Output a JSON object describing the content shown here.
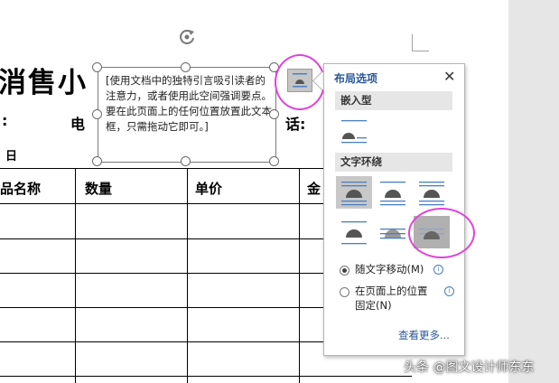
{
  "document": {
    "title_fragment": "消售小",
    "line1_left": ":",
    "line1_mid": "电",
    "line1_right": "话:",
    "line2_left": "日",
    "table_headers": [
      "品名称",
      "数量",
      "单价",
      "金"
    ]
  },
  "text_box": {
    "content": "[使用文档中的独特引言吸引读者的注意力，或者使用此空间强调要点。要在此页面上的任何位置放置此文本框，只需拖动它即可。]"
  },
  "layout_pane": {
    "title": "布局选项",
    "close": "✕",
    "inline_section": "嵌入型",
    "wrap_section": "文字环绕",
    "radio_move": "随文字移动(M)",
    "radio_fixed_line1": "在页面上的位置",
    "radio_fixed_line2": "固定(N)",
    "info_glyph": "i",
    "see_more": "查看更多..."
  },
  "watermark": "头条 @图文设计师东东",
  "colors": {
    "accent": "#2b579a",
    "highlight_circle": "#e043d8"
  }
}
